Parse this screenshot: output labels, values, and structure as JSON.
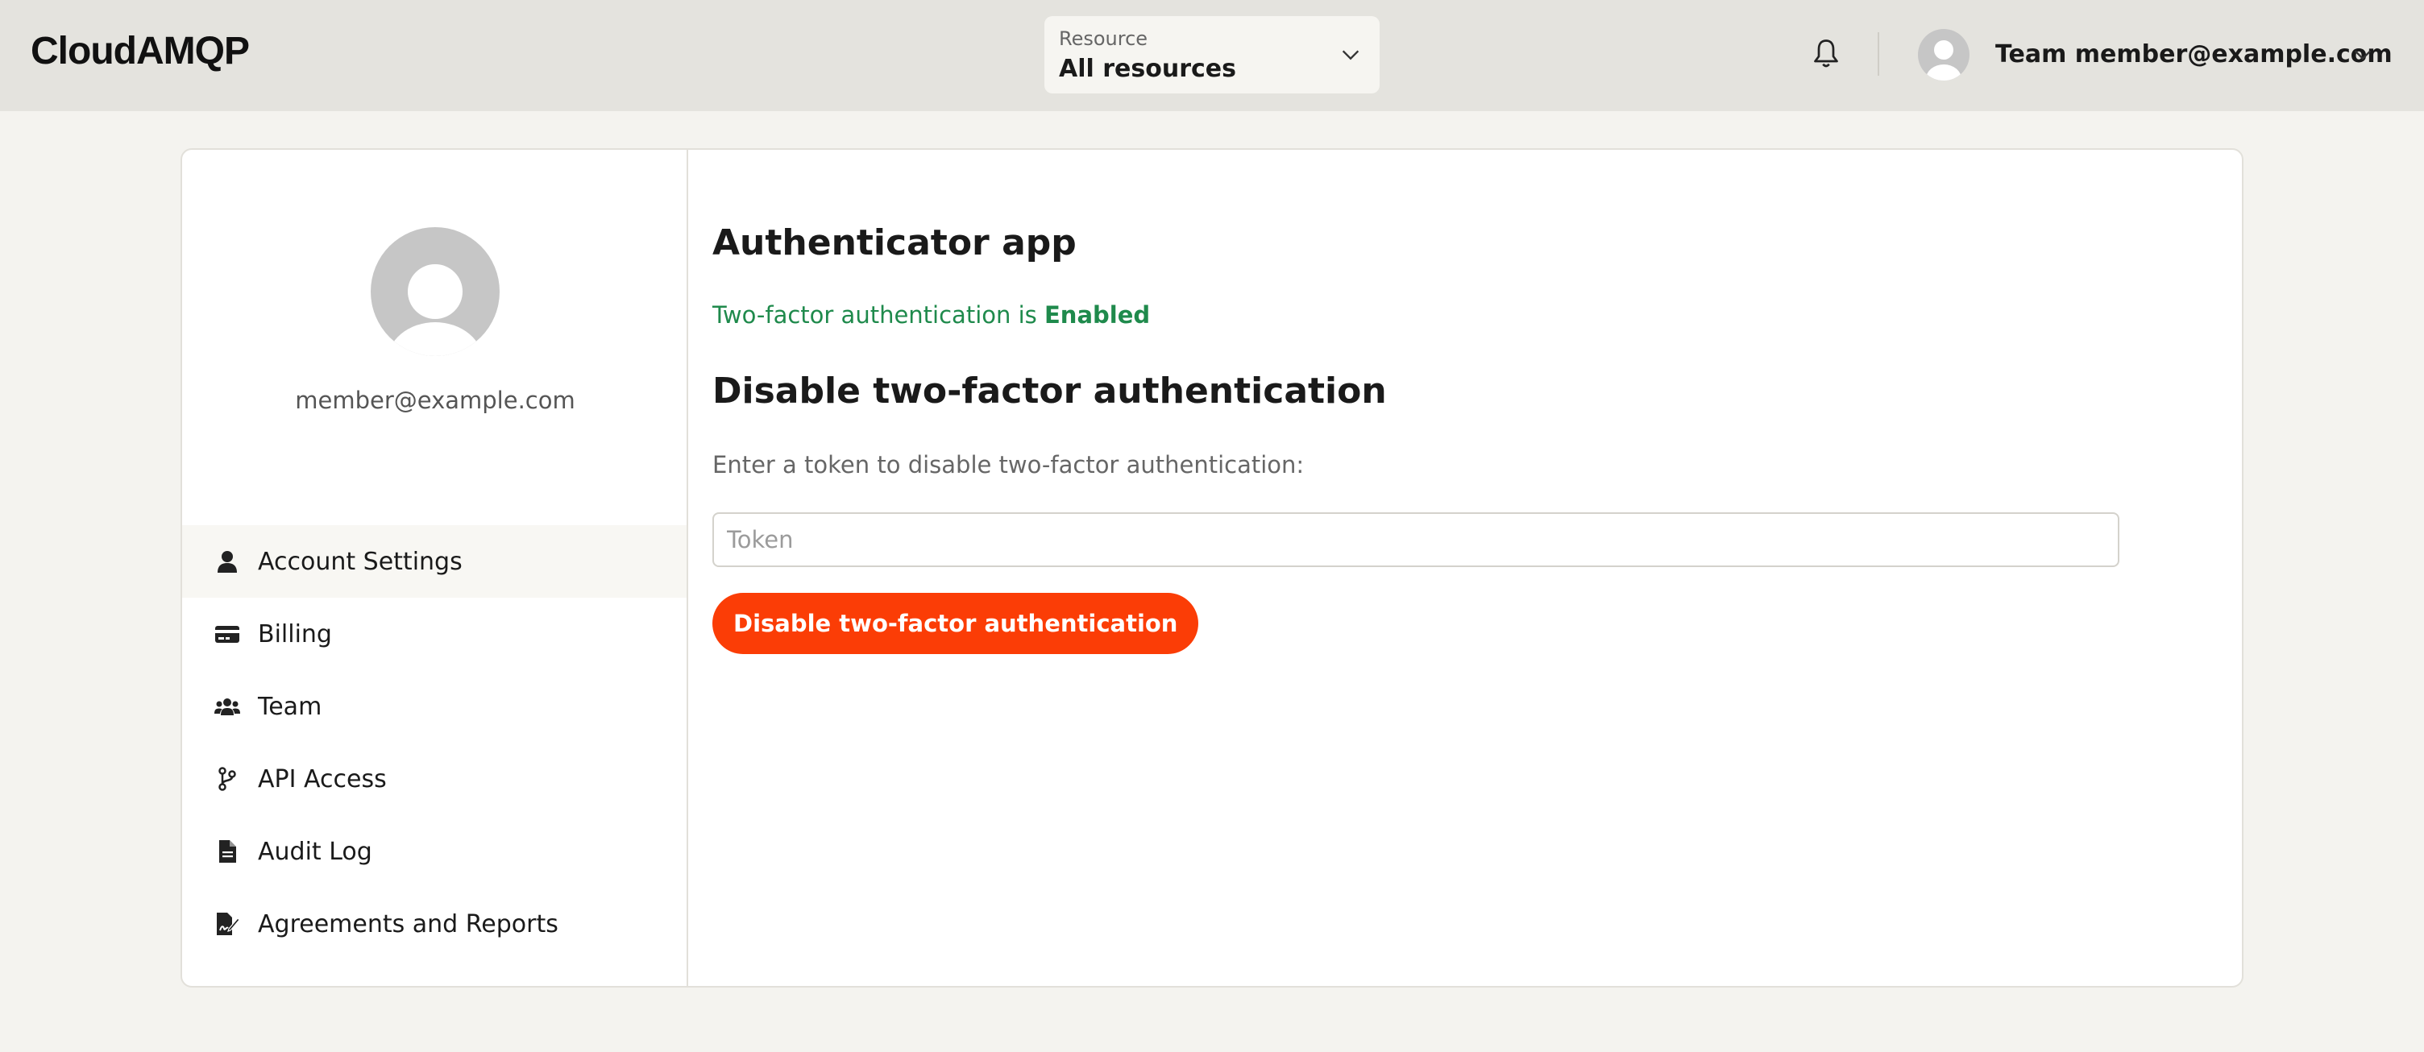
{
  "header": {
    "logo": "CloudAMQP",
    "resource": {
      "label": "Resource",
      "value": "All resources"
    },
    "user": {
      "name": "Team member@example.com"
    }
  },
  "sidebar": {
    "email": "member@example.com",
    "items": [
      {
        "label": "Account Settings",
        "icon": "person-icon",
        "active": true
      },
      {
        "label": "Billing",
        "icon": "credit-card-icon"
      },
      {
        "label": "Team",
        "icon": "users-icon"
      },
      {
        "label": "API Access",
        "icon": "code-branch-icon"
      },
      {
        "label": "Audit Log",
        "icon": "document-icon"
      },
      {
        "label": "Agreements and Reports",
        "icon": "signature-icon"
      }
    ]
  },
  "main": {
    "auth_heading": "Authenticator app",
    "status_prefix": "Two-factor authentication is ",
    "status_value": "Enabled",
    "disable_heading": "Disable two-factor authentication",
    "help_text": "Enter a token to disable two-factor authentication:",
    "token_placeholder": "Token",
    "token_value": "",
    "disable_button": "Disable two-factor authentication"
  },
  "colors": {
    "accent": "#fb3d06",
    "success": "#1f8a4c",
    "topbar": "#e4e3de",
    "page_bg": "#f4f3ef"
  }
}
